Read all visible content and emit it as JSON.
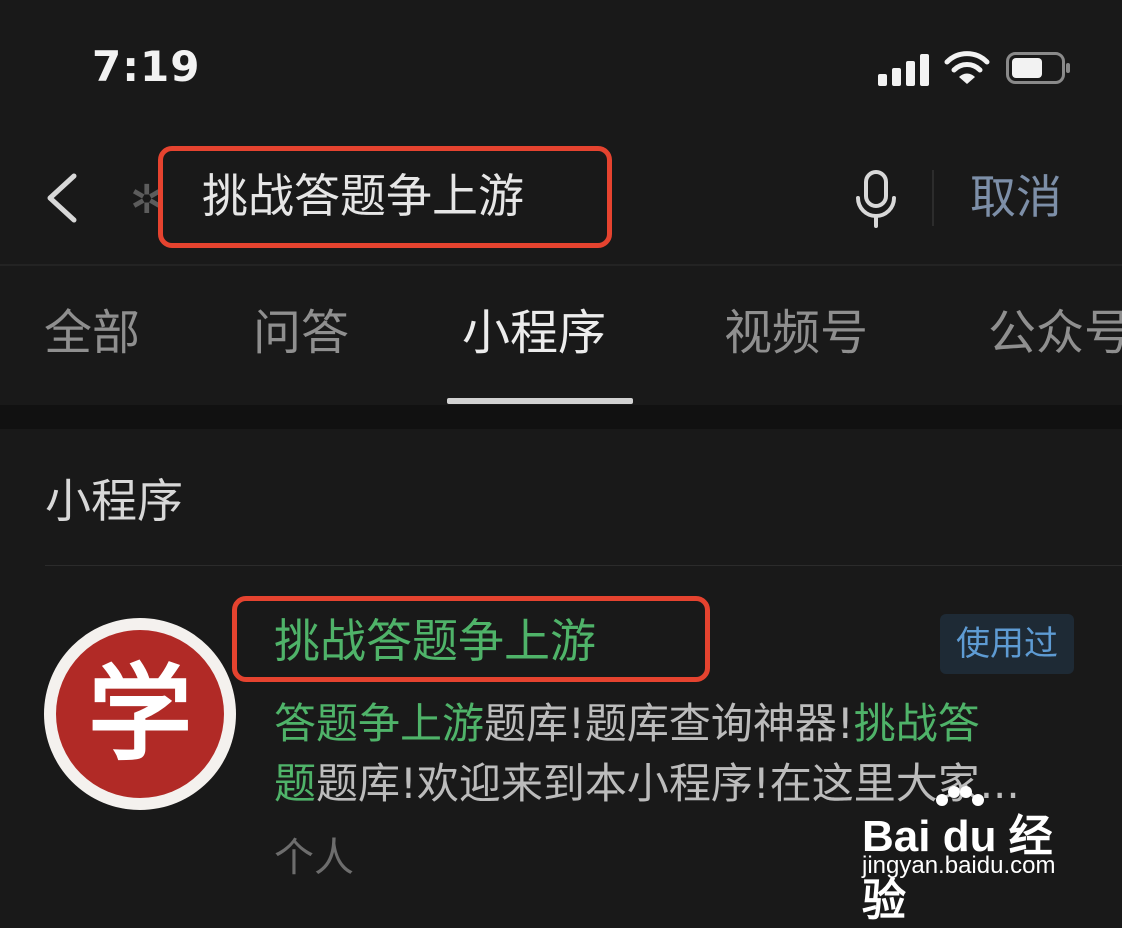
{
  "status_bar": {
    "time": "7:19"
  },
  "search": {
    "query": "挑战答题争上游",
    "cancel_label": "取消"
  },
  "tabs": [
    {
      "label": "全部"
    },
    {
      "label": "问答"
    },
    {
      "label": "小程序"
    },
    {
      "label": "视频号"
    },
    {
      "label": "公众号"
    }
  ],
  "section": {
    "title": "小程序"
  },
  "result": {
    "logo_char": "学",
    "title": "挑战答题争上游",
    "badge": "使用过",
    "desc": [
      {
        "text": "答题争上游",
        "highlight": true
      },
      {
        "text": "题库!题库查询神器!",
        "highlight": false
      },
      {
        "text": "挑战答",
        "highlight": true
      },
      {
        "text": "题",
        "highlight": true
      },
      {
        "text": "题库!欢迎来到本小程序!在这里大家...",
        "highlight": false
      }
    ],
    "owner": "个人"
  },
  "watermark": {
    "brand": "Bai du 经验",
    "url": "jingyan.baidu.com"
  },
  "colors": {
    "background": "#191919",
    "highlight_green": "#4fb369",
    "annotation_red": "#e5432f",
    "cancel_blue": "#7d8fa8"
  }
}
